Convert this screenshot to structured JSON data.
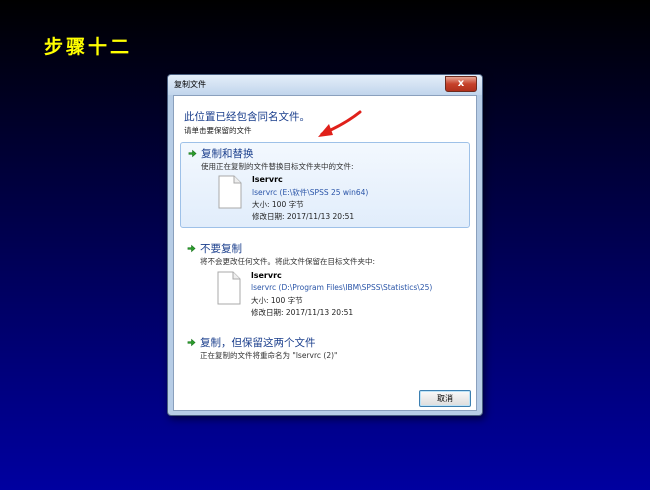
{
  "slide": {
    "title": "步骤十二",
    "title_color": "#ffff00"
  },
  "dialog": {
    "title": "复制文件",
    "close_glyph": "x",
    "heading": "此位置已经包含同名文件。",
    "subheading": "请单击要保留的文件",
    "options": [
      {
        "title": "复制和替换",
        "description": "使用正在复制的文件替换目标文件夹中的文件:",
        "file_name": "lservrc",
        "file_path": "lservrc (E:\\软件\\SPSS 25 win64)",
        "size": "大小: 100 字节",
        "modified": "修改日期: 2017/11/13 20:51"
      },
      {
        "title": "不要复制",
        "description": "将不会更改任何文件。将此文件保留在目标文件夹中:",
        "file_name": "lservrc",
        "file_path": "lservrc (D:\\Program Files\\IBM\\SPSS\\Statistics\\25)",
        "size": "大小: 100 字节",
        "modified": "修改日期: 2017/11/13 20:51"
      },
      {
        "title": "复制，但保留这两个文件",
        "description": "正在复制的文件将重命名为 \"lservrc (2)\""
      }
    ],
    "cancel_label": "取消"
  },
  "icons": {
    "option_arrow": "green-arrow-icon",
    "file": "file-icon",
    "annotation": "red-arrow-icon"
  },
  "colors": {
    "link_blue": "#1a3e8c",
    "arrow_green": "#2a9d2a",
    "annotation_red": "#e0201a"
  }
}
